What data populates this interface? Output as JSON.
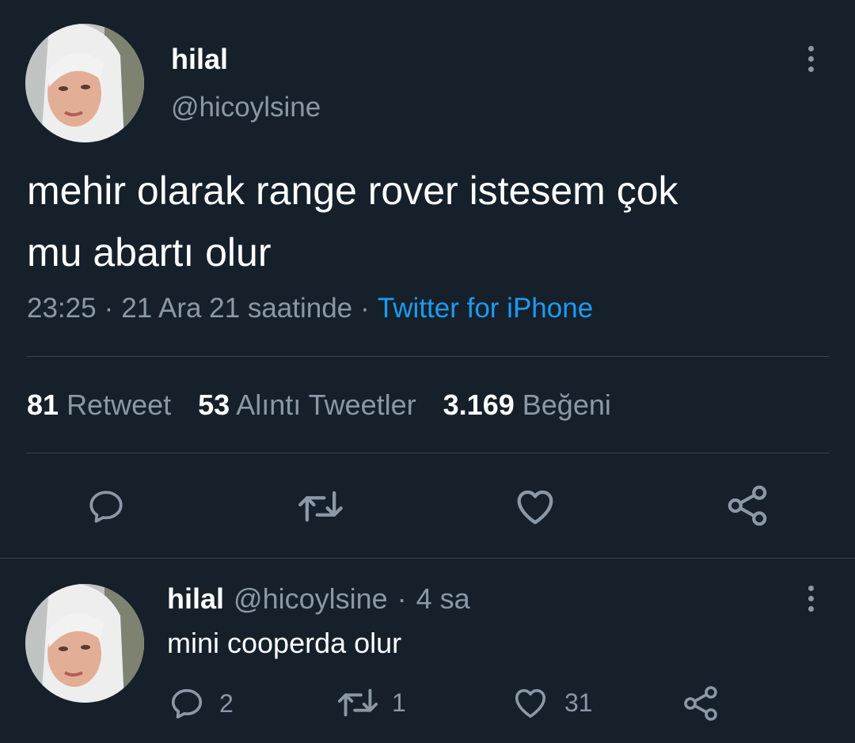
{
  "tweet": {
    "display_name": "hilal",
    "handle": "@hicoylsine",
    "text_line1": "mehir olarak range rover istesem çok",
    "text_line2": "mu abartı olur",
    "time": "23:25",
    "dot1": "·",
    "date": "21 Ara 21 saatinde",
    "dot2": "·",
    "source": "Twitter for iPhone",
    "stats": {
      "retweets_count": "81",
      "retweets_label": "Retweet",
      "quotes_count": "53",
      "quotes_label": "Alıntı Tweetler",
      "likes_count": "3.169",
      "likes_label": "Beğeni"
    },
    "actions": {
      "reply_icon": "reply-icon",
      "retweet_icon": "retweet-icon",
      "like_icon": "heart-icon",
      "share_icon": "share-icon"
    }
  },
  "reply": {
    "display_name": "hilal",
    "handle": "@hicoylsine",
    "dot": "·",
    "time_ago": "4 sa",
    "text": "mini cooperda olur",
    "reply_count": "2",
    "retweet_count": "1",
    "like_count": "31"
  },
  "colors": {
    "background": "#15202b",
    "text": "#ffffff",
    "muted": "#8b98a5",
    "link": "#1d9bf0",
    "divider": "#38444d"
  }
}
